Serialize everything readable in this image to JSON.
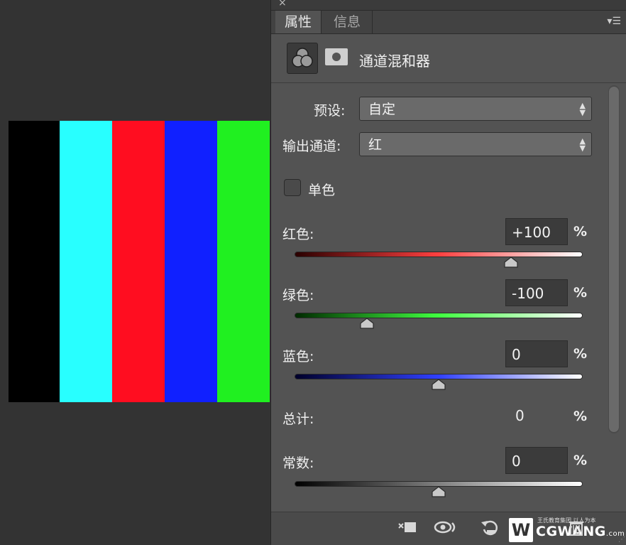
{
  "canvas": {
    "stripes": [
      {
        "name": "black",
        "color": "#000000"
      },
      {
        "name": "cyan",
        "color": "#28ffff"
      },
      {
        "name": "red",
        "color": "#ff0d20"
      },
      {
        "name": "blue",
        "color": "#1020ff"
      },
      {
        "name": "green",
        "color": "#20f020"
      }
    ]
  },
  "panel": {
    "close_icon": "×",
    "tabs": [
      {
        "label": "属性",
        "active": true
      },
      {
        "label": "信息",
        "active": false
      }
    ],
    "menu_icon": "panel-menu-icon",
    "title": "通道混和器",
    "preset": {
      "label": "预设:",
      "value": "自定"
    },
    "output_channel": {
      "label": "输出通道:",
      "value": "红"
    },
    "monochrome": {
      "label": "单色",
      "checked": false
    },
    "sliders": [
      {
        "key": "red",
        "label": "红色:",
        "value": "+100",
        "unit": "%",
        "position": 0.75,
        "gradient": [
          "#2a0000",
          "#ff4040",
          "#ffffff"
        ]
      },
      {
        "key": "green",
        "label": "绿色:",
        "value": "-100",
        "unit": "%",
        "position": 0.25,
        "gradient": [
          "#002a00",
          "#40ff40",
          "#ffffff"
        ]
      },
      {
        "key": "blue",
        "label": "蓝色:",
        "value": "0",
        "unit": "%",
        "position": 0.5,
        "gradient": [
          "#00002a",
          "#3040ff",
          "#ffffff"
        ]
      }
    ],
    "total": {
      "label": "总计:",
      "value": "0",
      "unit": "%"
    },
    "constant": {
      "label": "常数:",
      "value": "0",
      "unit": "%",
      "position": 0.5,
      "gradient": [
        "#000000",
        "#808080",
        "#ffffff"
      ]
    },
    "footer": {
      "icons": [
        "clip-to-layer-icon",
        "view-previous-state-icon",
        "reset-icon",
        "visibility-icon",
        "delete-icon"
      ]
    },
    "watermark": {
      "logo": "W",
      "subtitle": "王氏教育集团,以人为本",
      "name": "CGWANG",
      "suffix": ".com"
    }
  }
}
